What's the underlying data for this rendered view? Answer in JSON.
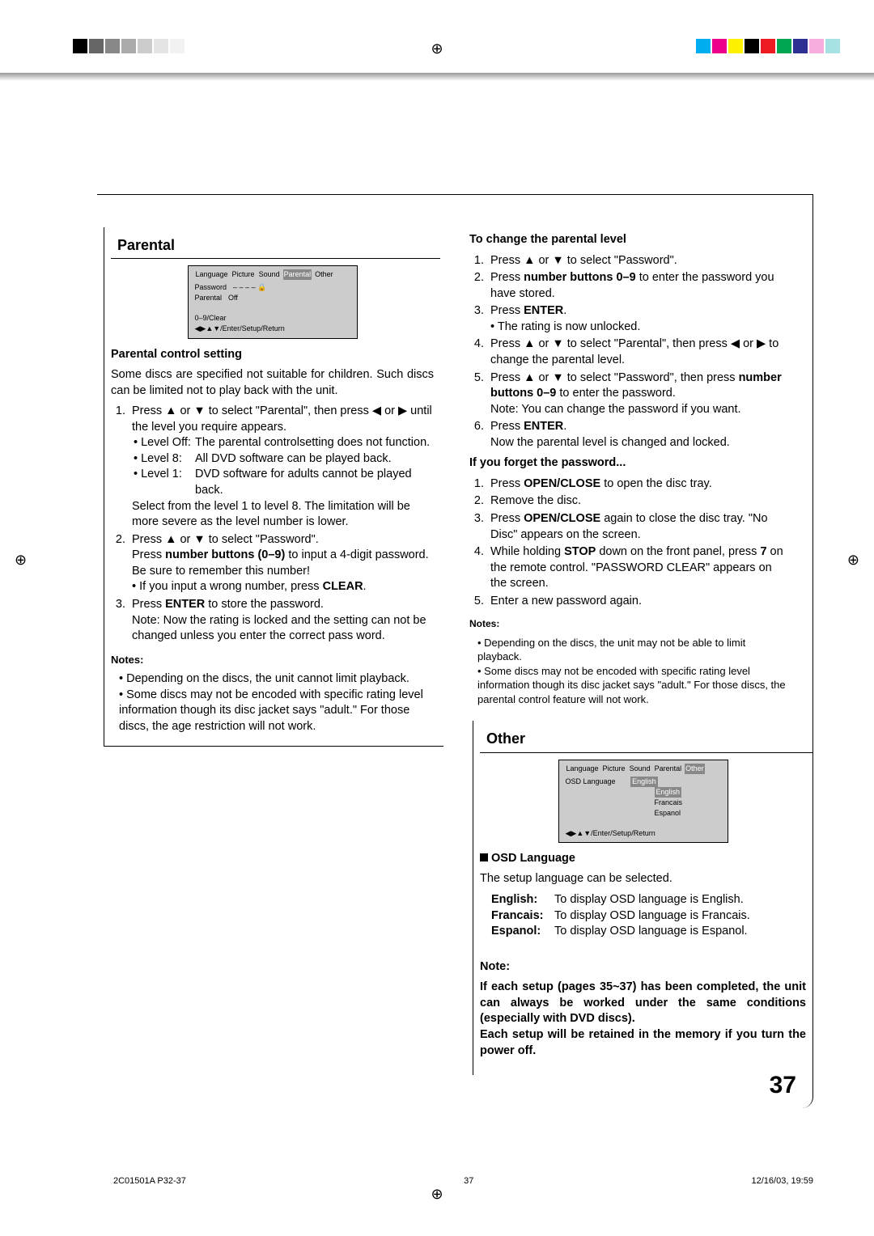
{
  "sections": {
    "parental_title": "Parental",
    "other_title": "Other"
  },
  "osd1": {
    "tabs": [
      "Language",
      "Picture",
      "Sound",
      "Parental",
      "Other"
    ],
    "sel": "Parental",
    "row1_k": "Password",
    "row1_v": "– – – – 🔒",
    "row2_k": "Parental",
    "row2_v": "Off",
    "hint": "0–9/Clear",
    "footer": "◀▶▲▼/Enter/Setup/Return"
  },
  "osd2": {
    "tabs": [
      "Language",
      "Picture",
      "Sound",
      "Parental",
      "Other"
    ],
    "sel": "Other",
    "row1_k": "OSD Language",
    "row1_v": "English",
    "opts": [
      "English",
      "Francais",
      "Espanol"
    ],
    "footer": "◀▶▲▼/Enter/Setup/Return"
  },
  "parental": {
    "sub": "Parental control setting",
    "intro": "Some discs are specified not suitable for children. Such discs can be limited not to play back with the unit.",
    "step1a": "Press ▲ or ▼ to select \"Parental\", then press ◀ or ▶ until the level you require appears.",
    "lev_off_k": "• Level Off:",
    "lev_off_v": "The parental controlsetting does not function.",
    "lev_8_k": "• Level 8:",
    "lev_8_v": "All DVD software can be played back.",
    "lev_1_k": "• Level 1:",
    "lev_1_v": "DVD software for adults cannot be played back.",
    "step1b": "Select from the level 1 to level 8. The limitation will be more severe as the level number is lower.",
    "step2a": "Press ▲ or ▼ to select \"Password\".",
    "step2b_pre": "Press ",
    "step2b_bold": "number buttons (0–9)",
    "step2b_post": " to input a 4-digit password. Be sure to remember this number!",
    "step2c": "• If you input a wrong number, press ",
    "step2c_bold": "CLEAR",
    "step3a_pre": "Press ",
    "step3a_bold": "ENTER",
    "step3a_post": " to store the password.",
    "step3b": "Note: Now the rating is locked and the setting can not be changed unless you enter the correct pass word.",
    "notes_h": "Notes:",
    "note1": "Depending on the discs, the unit cannot limit playback.",
    "note2": "Some discs may not be encoded with specific rating level information though its disc jacket says \"adult.\" For those discs, the age restriction will not work."
  },
  "change": {
    "h": "To change the parental level",
    "s1": "Press ▲ or ▼ to select \"Password\".",
    "s2_pre": "Press ",
    "s2_b": "number buttons 0–9",
    "s2_post": " to enter the password you have stored.",
    "s3_pre": "Press ",
    "s3_b": "ENTER",
    "s3_post": ".",
    "s3_bul": "• The rating is now unlocked.",
    "s4": "Press ▲ or ▼ to select \"Parental\", then press ◀ or ▶ to change the parental level.",
    "s5_a": "Press ▲ or ▼ to select \"Password\", then press ",
    "s5_b": "number buttons 0–9",
    "s5_c": " to enter the password.",
    "s5_note": "Note: You can change the password if you want.",
    "s6_pre": "Press ",
    "s6_b": "ENTER",
    "s6_post": ".",
    "s6_after": "Now the parental level is changed and locked."
  },
  "forget": {
    "h": "If you forget the password...",
    "s1_pre": "Press ",
    "s1_b": "OPEN/CLOSE",
    "s1_post": " to open the disc tray.",
    "s2": "Remove the disc.",
    "s3_pre": "Press ",
    "s3_b": "OPEN/CLOSE",
    "s3_post": " again to close the disc tray. \"No Disc\" appears on the screen.",
    "s4_pre": "While holding ",
    "s4_b1": "STOP",
    "s4_mid": " down on the front panel, press ",
    "s4_b2": "7",
    "s4_post": " on the remote control. \"PASSWORD CLEAR\" appears on the screen.",
    "s5": "Enter a new password again.",
    "notes_h": "Notes:",
    "n1": "Depending on the discs, the unit may not be able to limit playback.",
    "n2": "Some discs may not be encoded with specific rating level information though its disc jacket says \"adult.\" For those discs, the parental control feature will not work."
  },
  "other": {
    "osd_h": "OSD Language",
    "intro": "The setup language can be selected.",
    "e_k": "English:",
    "e_v": "To display OSD language is English.",
    "f_k": "Francais:",
    "f_v": "To display OSD language is Francais.",
    "s_k": "Espanol:",
    "s_v": "To display OSD language is Espanol.",
    "note_h": "Note:",
    "note_body": "If each setup (pages 35~37) has been completed, the unit can always be worked under the same conditions (especially with DVD discs).\nEach setup will be retained in the memory if you turn the power off."
  },
  "pagenum": "37",
  "footer": {
    "l": "2C01501A P32-37",
    "c": "37",
    "r": "12/16/03, 19:59"
  }
}
